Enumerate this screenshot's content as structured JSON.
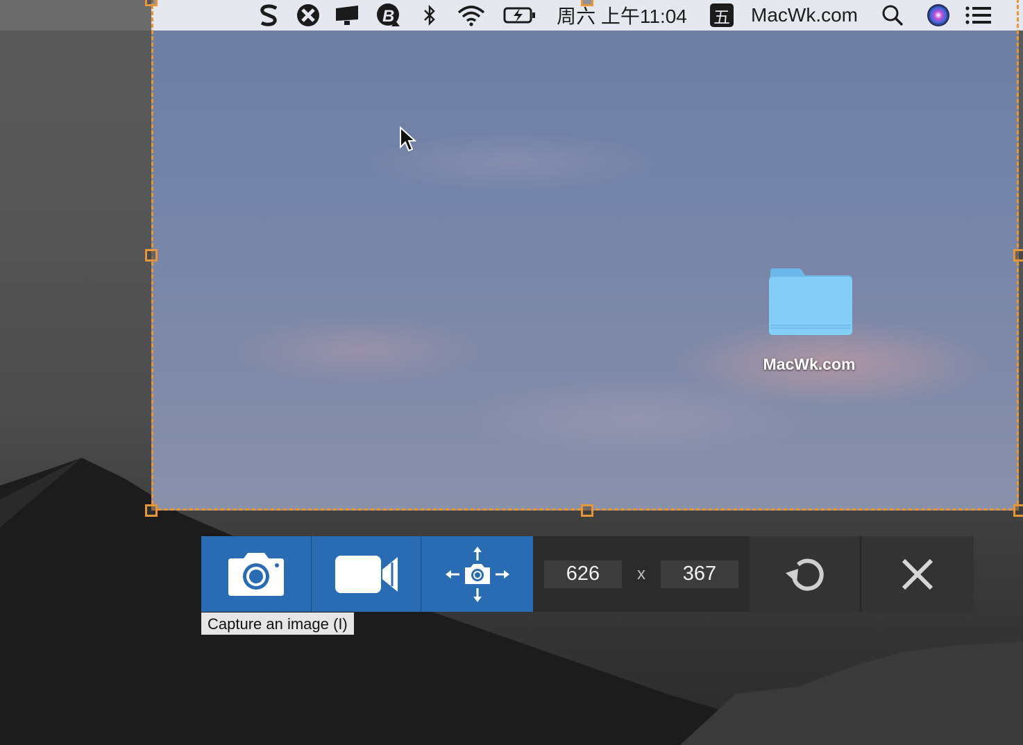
{
  "menubar": {
    "clock": "周六 上午11:04",
    "input_method_label": "五",
    "site_label": "MacWk.com",
    "status_icons": [
      "s-app-icon",
      "crossover-icon",
      "display-icon",
      "b-app-icon",
      "bluetooth-icon",
      "wifi-icon",
      "battery-charging-icon",
      "input-method-icon",
      "search-icon",
      "siri-icon",
      "notification-list-icon"
    ]
  },
  "desktop": {
    "folder_label": "MacWk.com"
  },
  "toolbar": {
    "buttons": [
      "camera-icon",
      "video-camera-icon",
      "move-capture-icon",
      "undo-icon",
      "close-icon"
    ],
    "width_value": "626",
    "separator": "x",
    "height_value": "367",
    "tooltip": "Capture an image (I)"
  },
  "colors": {
    "accent_blue": "#2a6cb4",
    "selection_orange": "#e8963a",
    "toolbar_dark": "#2b2b2b"
  }
}
